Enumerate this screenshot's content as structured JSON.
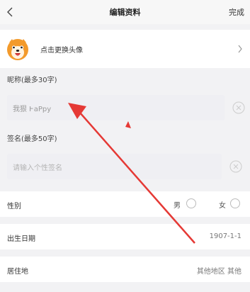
{
  "header": {
    "title": "编辑资料",
    "done_label": "完成"
  },
  "avatar_row": {
    "label": "点击更换头像"
  },
  "nickname": {
    "section_label": "昵称(最多30字)",
    "value": "我狠 ͰaPpy"
  },
  "signature": {
    "section_label": "签名(最多50字)",
    "placeholder": "请输入个性签名"
  },
  "gender": {
    "label": "性别",
    "male": "男",
    "female": "女"
  },
  "birthday": {
    "label": "出生日期",
    "value": "1907-1-1"
  },
  "residence": {
    "label": "居住地",
    "value": "其他地区 其他"
  },
  "colors": {
    "annotation_arrow": "#e53935"
  }
}
